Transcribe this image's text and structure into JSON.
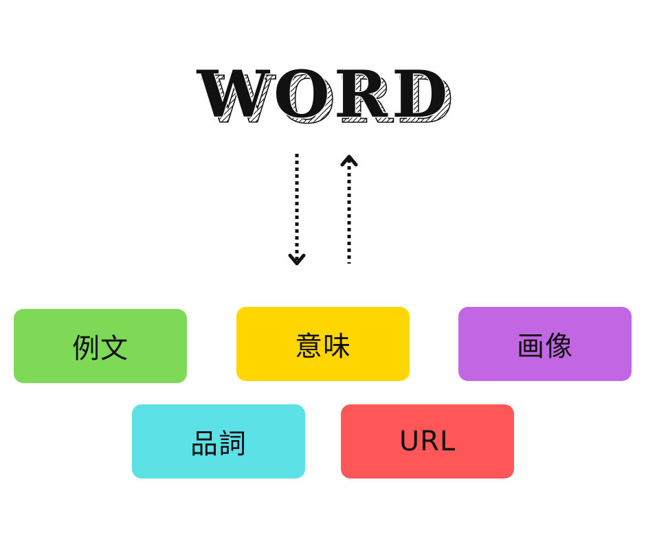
{
  "title": "WORD",
  "boxes": {
    "example": {
      "label": "例文",
      "color": "#7ED957"
    },
    "meaning": {
      "label": "意味",
      "color": "#FFD600"
    },
    "image": {
      "label": "画像",
      "color": "#C366E3"
    },
    "pos": {
      "label": "品詞",
      "color": "#5CE1E6"
    },
    "url": {
      "label": "URL",
      "color": "#FF5757"
    }
  },
  "arrows": [
    {
      "direction": "down",
      "style": "dotted"
    },
    {
      "direction": "up",
      "style": "dotted"
    }
  ]
}
